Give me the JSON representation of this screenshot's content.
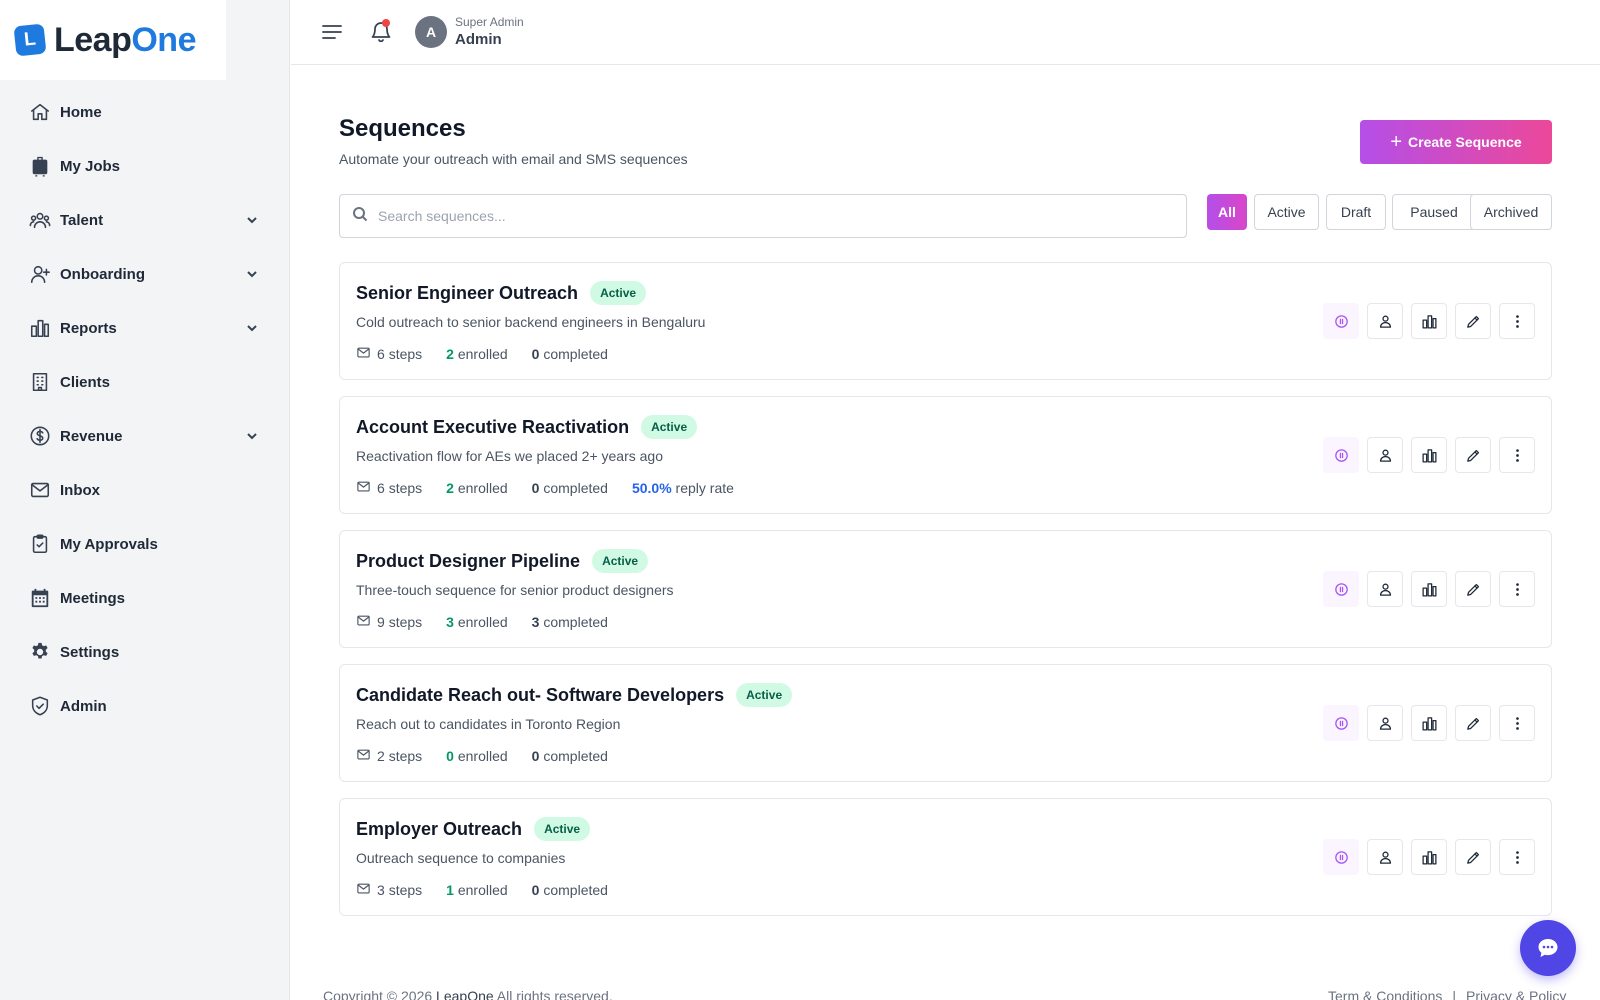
{
  "brand": {
    "name_part1": "Leap",
    "name_part2": "One",
    "mark": "L",
    "accent": "#1f7ae0"
  },
  "sidebar": {
    "items": [
      {
        "label": "Home",
        "icon": "home-icon",
        "expandable": false
      },
      {
        "label": "My Jobs",
        "icon": "briefcase-icon",
        "expandable": false
      },
      {
        "label": "Talent",
        "icon": "users-icon",
        "expandable": true
      },
      {
        "label": "Onboarding",
        "icon": "user-plus-icon",
        "expandable": true
      },
      {
        "label": "Reports",
        "icon": "bar-chart-icon",
        "expandable": true
      },
      {
        "label": "Clients",
        "icon": "building-icon",
        "expandable": false
      },
      {
        "label": "Revenue",
        "icon": "dollar-icon",
        "expandable": true
      },
      {
        "label": "Inbox",
        "icon": "mail-icon",
        "expandable": false
      },
      {
        "label": "My Approvals",
        "icon": "clipboard-check-icon",
        "expandable": false
      },
      {
        "label": "Meetings",
        "icon": "calendar-icon",
        "expandable": false
      },
      {
        "label": "Settings",
        "icon": "gear-icon",
        "expandable": false
      },
      {
        "label": "Admin",
        "icon": "shield-check-icon",
        "expandable": false
      }
    ]
  },
  "header": {
    "avatar_initial": "A",
    "user_role": "Super Admin",
    "user_name": "Admin",
    "notification_dot_color": "#ef4444"
  },
  "main": {
    "title": "Sequences",
    "subtitle": "Automate your outreach with email and SMS sequences",
    "create_button": "Create Sequence",
    "search_placeholder": "Search sequences...",
    "filters": [
      {
        "label": "All",
        "active": true
      },
      {
        "label": "Active",
        "active": false
      },
      {
        "label": "Draft",
        "active": false
      },
      {
        "label": "Paused",
        "active": false
      },
      {
        "label": "Archived",
        "active": false
      }
    ],
    "sequences": [
      {
        "name": "Senior Engineer Outreach",
        "status": "Active",
        "description": "Cold outreach to senior backend engineers in Bengaluru",
        "steps_count": "6",
        "steps_label": "steps",
        "enrolled_count": "2",
        "enrolled_label": "enrolled",
        "completed_count": "0",
        "completed_label": "completed",
        "reply_rate": null,
        "reply_label": null
      },
      {
        "name": "Account Executive Reactivation",
        "status": "Active",
        "description": "Reactivation flow for AEs we placed 2+ years ago",
        "steps_count": "6",
        "steps_label": "steps",
        "enrolled_count": "2",
        "enrolled_label": "enrolled",
        "completed_count": "0",
        "completed_label": "completed",
        "reply_rate": "50.0%",
        "reply_label": "reply rate"
      },
      {
        "name": "Product Designer Pipeline",
        "status": "Active",
        "description": "Three-touch sequence for senior product designers",
        "steps_count": "9",
        "steps_label": "steps",
        "enrolled_count": "3",
        "enrolled_label": "enrolled",
        "completed_count": "3",
        "completed_label": "completed",
        "reply_rate": null,
        "reply_label": null
      },
      {
        "name": "Candidate Reach out- Software Developers",
        "status": "Active",
        "description": "Reach out to candidates in Toronto Region",
        "steps_count": "2",
        "steps_label": "steps",
        "enrolled_count": "0",
        "enrolled_label": "enrolled",
        "completed_count": "0",
        "completed_label": "completed",
        "reply_rate": null,
        "reply_label": null
      },
      {
        "name": "Employer Outreach",
        "status": "Active",
        "description": "Outreach sequence to companies",
        "steps_count": "3",
        "steps_label": "steps",
        "enrolled_count": "1",
        "enrolled_label": "enrolled",
        "completed_count": "0",
        "completed_label": "completed",
        "reply_rate": null,
        "reply_label": null
      }
    ],
    "row_actions": [
      "pause-icon",
      "users-icon",
      "bar-chart-icon",
      "pencil-icon",
      "more-vertical-icon"
    ]
  },
  "footer": {
    "copyright_prefix": "Copyright © 2026",
    "copyright_brand": "LeapOne",
    "copyright_suffix": "All rights reserved.",
    "terms": "Term & Conditions",
    "separator": "|",
    "privacy": "Privacy & Policy"
  },
  "colors": {
    "primary_gradient_start": "#b44fe8",
    "primary_gradient_end": "#ec4899",
    "active_badge_bg": "#d1fae5",
    "active_badge_text": "#065f46",
    "chat_button": "#4f46e5"
  }
}
